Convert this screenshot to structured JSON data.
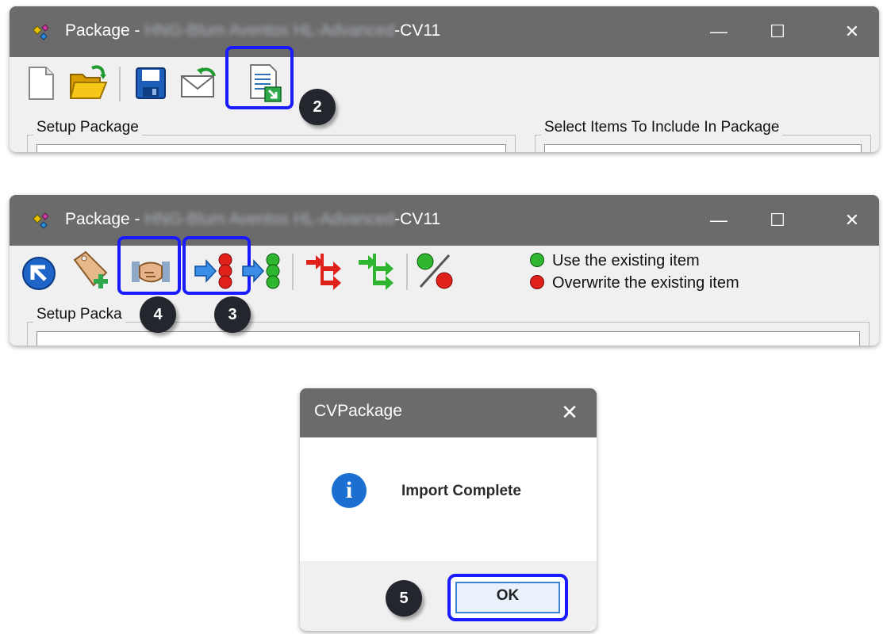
{
  "window1": {
    "title_prefix": "Package - ",
    "title_blurred": "HNG-Blum Aventos HL-Advanced",
    "title_suffix": "-CV11",
    "minimize": "—",
    "maximize": "☐",
    "close": "✕",
    "toolbar": [
      "new-document-icon",
      "open-folder-icon",
      "save-icon",
      "email-icon",
      "import-icon"
    ],
    "badge": "2",
    "left_group_label": "Setup Package",
    "right_group_label": "Select Items To Include In Package"
  },
  "window2": {
    "title_prefix": "Package - ",
    "title_blurred": "HNG-Blum Aventos HL-Advanced",
    "title_suffix": "-CV11",
    "minimize": "—",
    "maximize": "☐",
    "close": "✕",
    "badge_handshake": "4",
    "badge_overwrite": "3",
    "group_label": "Setup Packa",
    "legend": [
      {
        "label": "Use the existing item",
        "color": "#2fb52f"
      },
      {
        "label": "Overwrite the existing item",
        "color": "#e0201a"
      }
    ]
  },
  "dialog": {
    "title": "CVPackage",
    "close": "✕",
    "message": "Import Complete",
    "info_glyph": "i",
    "ok_label": "OK",
    "badge": "5"
  },
  "colors": {
    "titlebar": "#6b6b6b",
    "highlight": "#1a1aff",
    "badge": "#24262d",
    "info": "#1b6fd1"
  }
}
